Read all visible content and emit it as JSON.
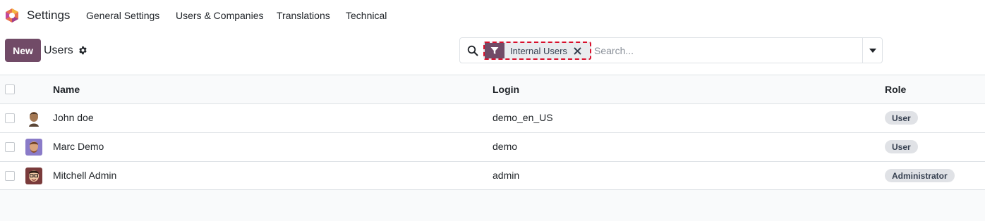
{
  "navbar": {
    "app_title": "Settings",
    "menus": [
      "General Settings",
      "Users & Companies",
      "Translations",
      "Technical"
    ]
  },
  "control": {
    "new_label": "New",
    "breadcrumb": "Users",
    "search": {
      "facet_label": "Internal Users",
      "placeholder": "Search..."
    }
  },
  "table": {
    "columns": [
      "Name",
      "Login",
      "Role"
    ],
    "rows": [
      {
        "name": "John doe",
        "login": "demo_en_US",
        "role": "User"
      },
      {
        "name": "Marc Demo",
        "login": "demo",
        "role": "User"
      },
      {
        "name": "Mitchell Admin",
        "login": "admin",
        "role": "Administrator"
      }
    ]
  },
  "colors": {
    "brand": "#714b67",
    "facet_outline": "#d8102c"
  },
  "icons": [
    "app-logo-icon",
    "gear-icon",
    "search-icon",
    "filter-icon",
    "close-icon",
    "caret-down-icon"
  ]
}
